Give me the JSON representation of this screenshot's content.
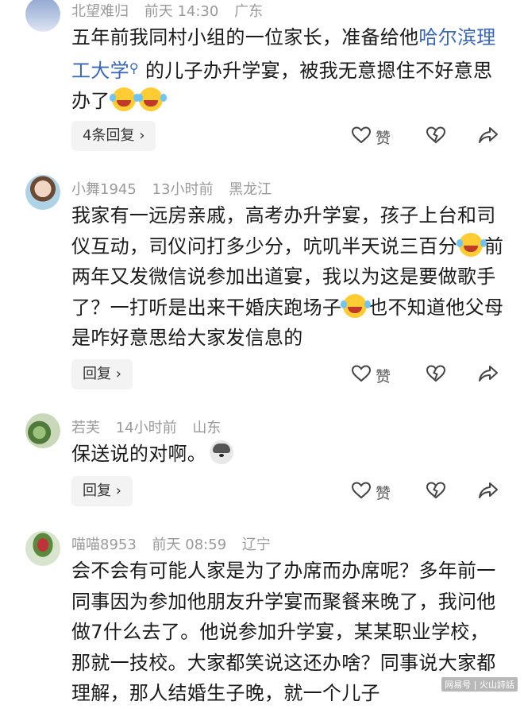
{
  "comments": [
    {
      "user": "北望难归",
      "time": "前天 14:30",
      "location": "广东",
      "text_before": "五年前我同村小组的一位家长，准备给他",
      "link_text": "哈尔滨理工大学",
      "text_after": " 的儿子办升学宴，被我无意摁住不好意思办了",
      "reply_label": "4条回复",
      "like_label": "赞"
    },
    {
      "user": "小舞1945",
      "time": "13小时前",
      "location": "黑龙江",
      "text_1": "我家有一远房亲戚，高考办升学宴，孩子上台和司仪互动，司仪问打多少分，吭叽半天说三百分",
      "text_2": "前两年又发微信说参加出道宴，我以为这是要做歌手了？一打听是出来干婚庆跑场子",
      "text_3": "也不知道他父母是咋好意思给大家发信息的",
      "reply_label": "回复",
      "like_label": "赞"
    },
    {
      "user": "若芙",
      "time": "14小时前",
      "location": "山东",
      "text": "保送说的对啊。",
      "reply_label": "回复",
      "like_label": "赞"
    },
    {
      "user": "喵喵8953",
      "time": "前天 08:59",
      "location": "辽宁",
      "text": "会不会有可能人家是为了办席而办席呢？多年前一同事因为参加他朋友升学宴而聚餐来晚了，我问他做7什么去了。他说参加升学宴，某某职业学校，那就一技校。大家都笑说这还办啥？同事说大家都理解，那人结婚生子晚，就一个儿子"
    }
  ],
  "watermark": "网易号 | 火山詩話"
}
